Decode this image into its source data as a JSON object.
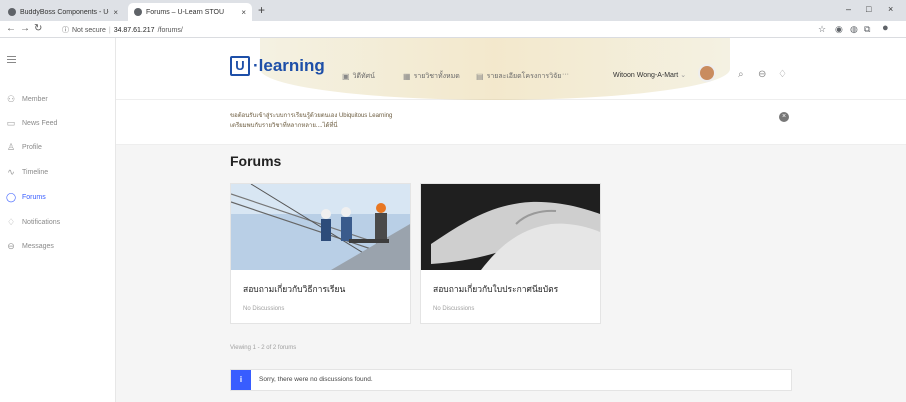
{
  "browser": {
    "tabs": [
      {
        "title": "BuddyBoss Components - U-Lea",
        "active": false
      },
      {
        "title": "Forums – U-Learn STOU",
        "active": true
      }
    ],
    "new_tab": "+",
    "url_security": "Not secure",
    "url_host": "34.87.61.217",
    "url_path": "/forums/",
    "window_controls": [
      "–",
      "□",
      "×"
    ]
  },
  "sidebar": {
    "items": [
      {
        "label": "Member",
        "icon": "member-icon",
        "active": false
      },
      {
        "label": "News Feed",
        "icon": "news-feed-icon",
        "active": false
      },
      {
        "label": "Profile",
        "icon": "profile-icon",
        "active": false
      },
      {
        "label": "Timeline",
        "icon": "timeline-icon",
        "active": false
      },
      {
        "label": "Forums",
        "icon": "forums-icon",
        "active": true
      },
      {
        "label": "Notifications",
        "icon": "notifications-icon",
        "active": false
      },
      {
        "label": "Messages",
        "icon": "messages-icon",
        "active": false
      }
    ]
  },
  "header": {
    "logo_letter": "U",
    "logo_word_accent": "·learning",
    "menu": [
      {
        "label": "วิดีทัศน์",
        "icon": "video-icon"
      },
      {
        "label": "รายวิชาทั้งหมด",
        "icon": "courses-icon"
      },
      {
        "label": "รายละเอียดโครงการวิจัย",
        "icon": "research-icon"
      },
      {
        "label": "···",
        "icon": ""
      }
    ],
    "user_name": "Witoon Wong-A-Mart",
    "user_caret": "⌄"
  },
  "notice": {
    "line1": "ขอต้อนรับเข้าสู่ระบบการเรียนรู้ด้วยตนเอง Ubiquitous Learning",
    "line2": "เตรียมพบกับรายวิชาที่หลากหลาย....ได้ที่นี่",
    "close_symbol": "×"
  },
  "main": {
    "title": "Forums",
    "forums": [
      {
        "title": "สอบถามเกี่ยวกับวิธีการเรียน",
        "subtitle": "No Discussions"
      },
      {
        "title": "สอบถามเกี่ยวกับใบประกาศนียบัตร",
        "subtitle": "No Discussions"
      }
    ],
    "viewing": "Viewing 1 - 2 of 2 forums",
    "info_badge": "i",
    "info_message": "Sorry, there were no discussions found."
  },
  "colors": {
    "accent": "#385dff",
    "brand": "#1e4fa8"
  }
}
